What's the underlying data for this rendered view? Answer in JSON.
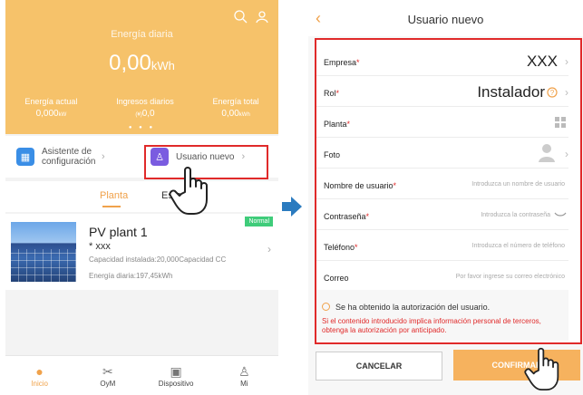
{
  "left_screen": {
    "hero": {
      "title": "Energía diaria",
      "value": "0,00",
      "unit": "kWh",
      "stats": [
        {
          "label": "Energía actual",
          "value": "0,000",
          "unit": "kW"
        },
        {
          "label": "Ingresos diarios",
          "value": "0,0",
          "unit": "(¥)"
        },
        {
          "label": "Energía total",
          "value": "0,00",
          "unit": "kWh"
        }
      ]
    },
    "shortcuts": {
      "wizard_label": "Asistente de configuración",
      "new_user_label": "Usuario nuevo"
    },
    "tabs": {
      "plant": "Planta",
      "state": "Esta"
    },
    "plant_card": {
      "badge": "Normal",
      "name": "PV plant 1",
      "owner": "* xxx",
      "capacity": "Capacidad instalada:20,000Capacidad CC",
      "daily_energy": "Energía diaria:197,45kWh"
    },
    "bottom_nav": [
      {
        "label": "Inicio",
        "icon": "home-icon"
      },
      {
        "label": "OyM",
        "icon": "tools-icon"
      },
      {
        "label": "Dispositivo",
        "icon": "device-icon"
      },
      {
        "label": "Mi",
        "icon": "person-icon"
      }
    ]
  },
  "right_screen": {
    "title": "Usuario nuevo",
    "fields": {
      "empresa": {
        "label": "Empresa",
        "value": "XXX"
      },
      "rol": {
        "label": "Rol",
        "value": "Instalador"
      },
      "planta": {
        "label": "Planta"
      },
      "foto": {
        "label": "Foto"
      },
      "usuario": {
        "label": "Nombre de usuario",
        "placeholder": "Introduzca un nombre de usuario"
      },
      "password": {
        "label": "Contraseña",
        "placeholder": "Introduzca la contraseña"
      },
      "telefono": {
        "label": "Teléfono",
        "placeholder": "Introduzca el número de teléfono"
      },
      "correo": {
        "label": "Correo",
        "placeholder": "Por favor ingrese su correo electrónico"
      }
    },
    "auth": {
      "check_label": "Se ha obtenido la autorización del usuario.",
      "warning": "Si el contenido introducido implica información personal de terceros, obtenga la autorización por anticipado."
    },
    "buttons": {
      "cancel": "CANCELAR",
      "confirm": "CONFIRMAR"
    }
  },
  "colors": {
    "accent": "#f0a24b",
    "hero": "#f6c26a",
    "highlight": "#e02a2a",
    "arrow": "#2b7bbf"
  }
}
